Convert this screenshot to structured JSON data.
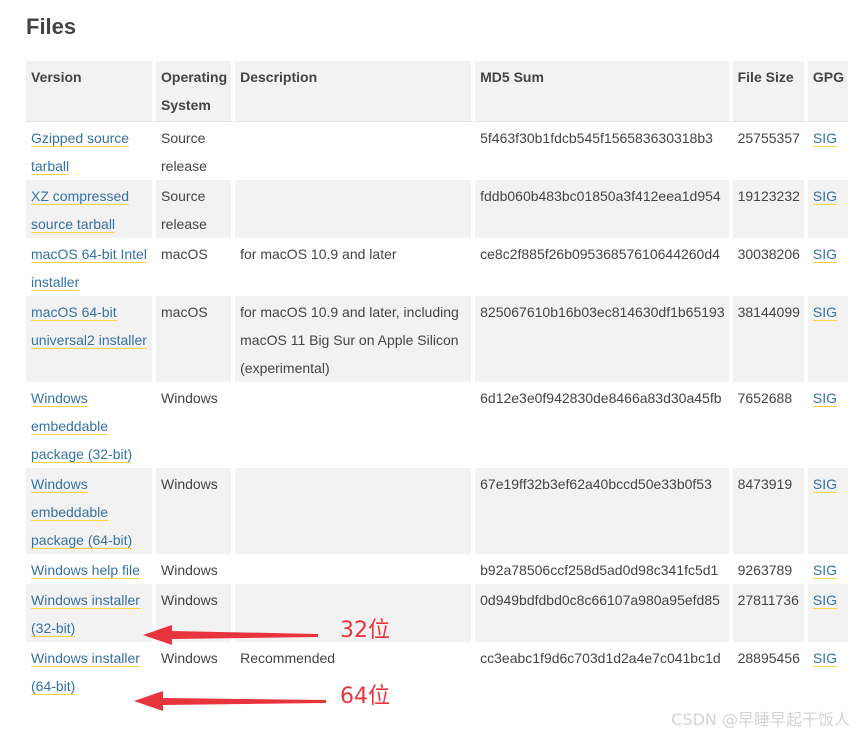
{
  "page": {
    "title": "Files"
  },
  "table": {
    "headers": [
      "Version",
      "Operating System",
      "Description",
      "MD5 Sum",
      "File Size",
      "GPG"
    ],
    "rows": [
      [
        "Gzipped source tarball",
        "Source release",
        "",
        "5f463f30b1fdcb545f156583630318b3",
        "25755357",
        "SIG"
      ],
      [
        "XZ compressed source tarball",
        "Source release",
        "",
        "fddb060b483bc01850a3f412eea1d954",
        "19123232",
        "SIG"
      ],
      [
        "macOS 64-bit Intel installer",
        "macOS",
        "for macOS 10.9 and later",
        "ce8c2f885f26b09536857610644260d4",
        "30038206",
        "SIG"
      ],
      [
        "macOS 64-bit universal2 installer",
        "macOS",
        "for macOS 10.9 and later, including macOS 11 Big Sur on Apple Silicon (experimental)",
        "825067610b16b03ec814630df1b65193",
        "38144099",
        "SIG"
      ],
      [
        "Windows embeddable package (32-bit)",
        "Windows",
        "",
        "6d12e3e0f942830de8466a83d30a45fb",
        "7652688",
        "SIG"
      ],
      [
        "Windows embeddable package (64-bit)",
        "Windows",
        "",
        "67e19ff32b3ef62a40bccd50e33b0f53",
        "8473919",
        "SIG"
      ],
      [
        "Windows help file",
        "Windows",
        "",
        "b92a78506ccf258d5ad0d98c341fc5d1",
        "9263789",
        "SIG"
      ],
      [
        "Windows installer (32-bit)",
        "Windows",
        "",
        "0d949bdfdbd0c8c66107a980a95efd85",
        "27811736",
        "SIG"
      ],
      [
        "Windows installer (64-bit)",
        "Windows",
        "Recommended",
        "cc3eabc1f9d6c703d1d2a4e7c041bc1d",
        "28895456",
        "SIG"
      ]
    ]
  },
  "annotations": {
    "label_32": "32位",
    "label_64": "64位",
    "arrow_color": "#e8353d"
  },
  "watermark": "CSDN @早睡早起干饭人"
}
